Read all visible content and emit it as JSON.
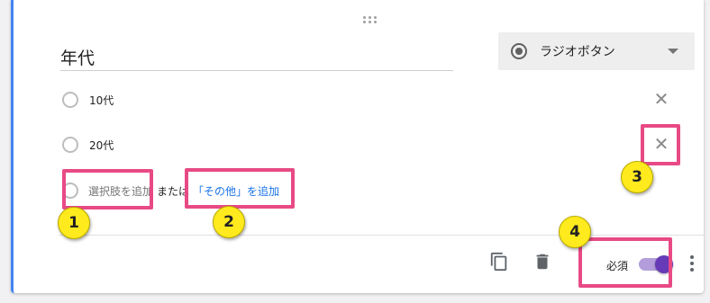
{
  "question": {
    "title": "年代",
    "type_label": "ラジオボタン"
  },
  "options": [
    {
      "label": "10代"
    },
    {
      "label": "20代"
    }
  ],
  "add_row": {
    "add_option": "選択肢を追加",
    "or_text": "または",
    "add_other": "「その他」を追加"
  },
  "footer": {
    "required_label": "必須",
    "required_on": true
  },
  "callouts": [
    {
      "number": "1"
    },
    {
      "number": "2"
    },
    {
      "number": "3"
    },
    {
      "number": "4"
    }
  ],
  "icons": {
    "type": "radio-button-icon",
    "dropdown": "dropdown-caret-icon",
    "remove": "close-icon",
    "duplicate": "copy-icon",
    "delete": "trash-icon",
    "more": "more-vert-icon",
    "drag": "drag-handle-icon"
  },
  "colors": {
    "accent": "#673ab7",
    "link": "#1a73e8",
    "highlight": "#e84a85",
    "badge": "#ffea1e",
    "left_border": "#4285f4"
  }
}
